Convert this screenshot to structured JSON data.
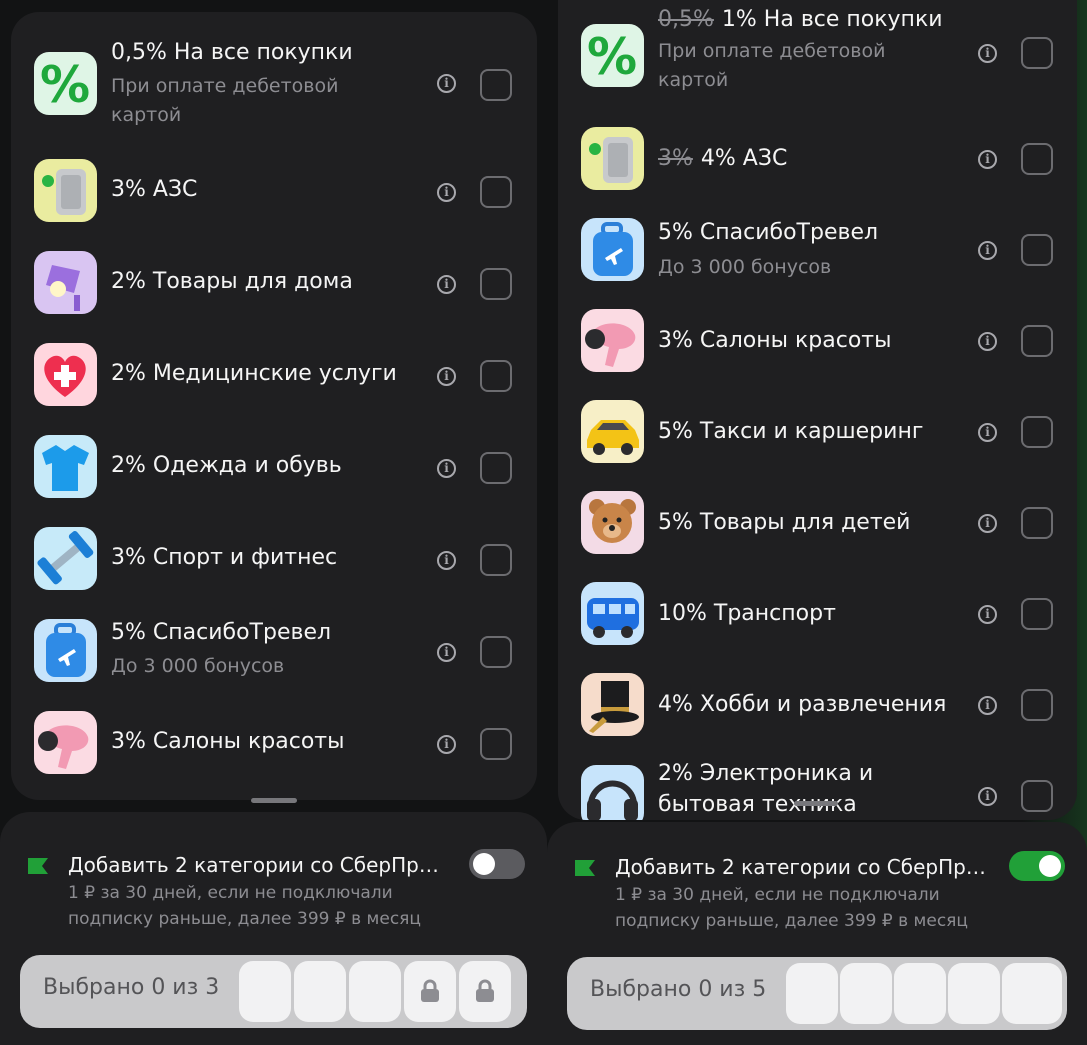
{
  "left": {
    "categories": [
      {
        "title": "0,5% На все покупки",
        "subtitle": "При оплате дебетовой картой",
        "icon": "percent-icon"
      },
      {
        "title": "3% АЗС",
        "icon": "fuel-canister-icon"
      },
      {
        "title": "2% Товары для дома",
        "icon": "lamp-icon"
      },
      {
        "title": "2% Медицинские услуги",
        "icon": "medical-heart-icon"
      },
      {
        "title": "2% Одежда и обувь",
        "icon": "tshirt-icon"
      },
      {
        "title": "3% Спорт и фитнес",
        "icon": "dumbbell-icon"
      },
      {
        "title": "5% СпасибоТревел",
        "subtitle": "До 3 000 бонусов",
        "icon": "suitcase-icon"
      },
      {
        "title": "3% Салоны красоты",
        "icon": "hairdryer-icon"
      }
    ],
    "promo": {
      "title": "Добавить 2 категории со СберПр…",
      "subtitle": "1 ₽ за 30 дней, если не подключали подписку раньше, далее 399 ₽ в месяц",
      "toggle_on": false
    },
    "selection": {
      "label": "Выбрано 0 из 3",
      "slots": 5,
      "locked_slots": 2
    }
  },
  "right": {
    "categories": [
      {
        "old": "0,5%",
        "title": "1% На все покупки",
        "subtitle": "При оплате дебетовой картой",
        "icon": "percent-icon"
      },
      {
        "old": "3%",
        "title": "4% АЗС",
        "icon": "fuel-canister-icon"
      },
      {
        "title": "5% СпасибоТревел",
        "subtitle": "До 3 000 бонусов",
        "icon": "suitcase-icon"
      },
      {
        "title": "3% Салоны красоты",
        "icon": "hairdryer-icon"
      },
      {
        "title": "5% Такси и каршеринг",
        "icon": "taxi-car-icon"
      },
      {
        "title": "5% Товары для детей",
        "icon": "teddy-bear-icon"
      },
      {
        "title": "10% Транспорт",
        "icon": "bus-icon"
      },
      {
        "title": "4% Хобби и развлечения",
        "icon": "top-hat-icon"
      },
      {
        "title": "2% Электроника и бытовая техника",
        "icon": "headphones-icon"
      }
    ],
    "promo": {
      "title": "Добавить 2 категории со СберПр…",
      "subtitle": "1 ₽ за 30 дней, если не подключали подписку раньше, далее 399 ₽ в месяц",
      "toggle_on": true
    },
    "selection": {
      "label": "Выбрано 0 из 5",
      "slots": 5,
      "locked_slots": 0
    }
  },
  "colors": {
    "accent": "#21a038",
    "background": "#1f1f21",
    "muted_text": "#8d8d92"
  }
}
